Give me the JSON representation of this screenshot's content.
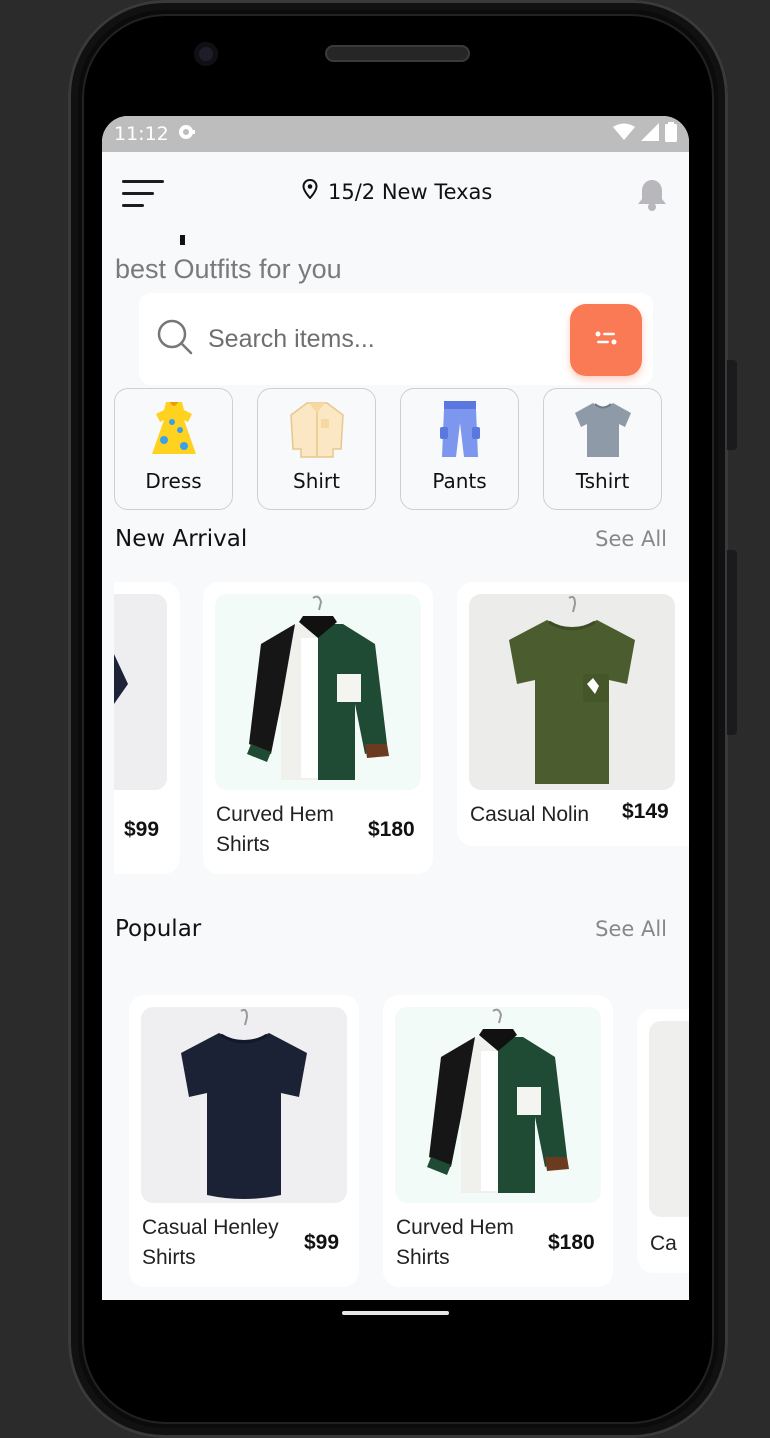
{
  "status": {
    "time": "11:12"
  },
  "header": {
    "location": "15/2 New Texas"
  },
  "tagline": "best Outfits for you",
  "search": {
    "placeholder": "Search items..."
  },
  "categories": [
    {
      "label": "Dress",
      "icon": "dress-icon"
    },
    {
      "label": "Shirt",
      "icon": "shirt-icon"
    },
    {
      "label": "Pants",
      "icon": "pants-icon"
    },
    {
      "label": "Tshirt",
      "icon": "tshirt-icon"
    }
  ],
  "new_arrival": {
    "title": "New Arrival",
    "see_all": "See All",
    "items": [
      {
        "name": "",
        "price": "$99"
      },
      {
        "name": "Curved Hem Shirts",
        "price": "$180"
      },
      {
        "name": "Casual Nolin",
        "price": "$149"
      }
    ]
  },
  "popular": {
    "title": "Popular",
    "see_all": "See All",
    "items": [
      {
        "name": "Casual Henley Shirts",
        "price": "$99"
      },
      {
        "name": "Curved Hem Shirts",
        "price": "$180"
      },
      {
        "name": "Ca",
        "price": ""
      }
    ]
  },
  "colors": {
    "accent": "#f97a55",
    "background": "#f8f9fb"
  }
}
